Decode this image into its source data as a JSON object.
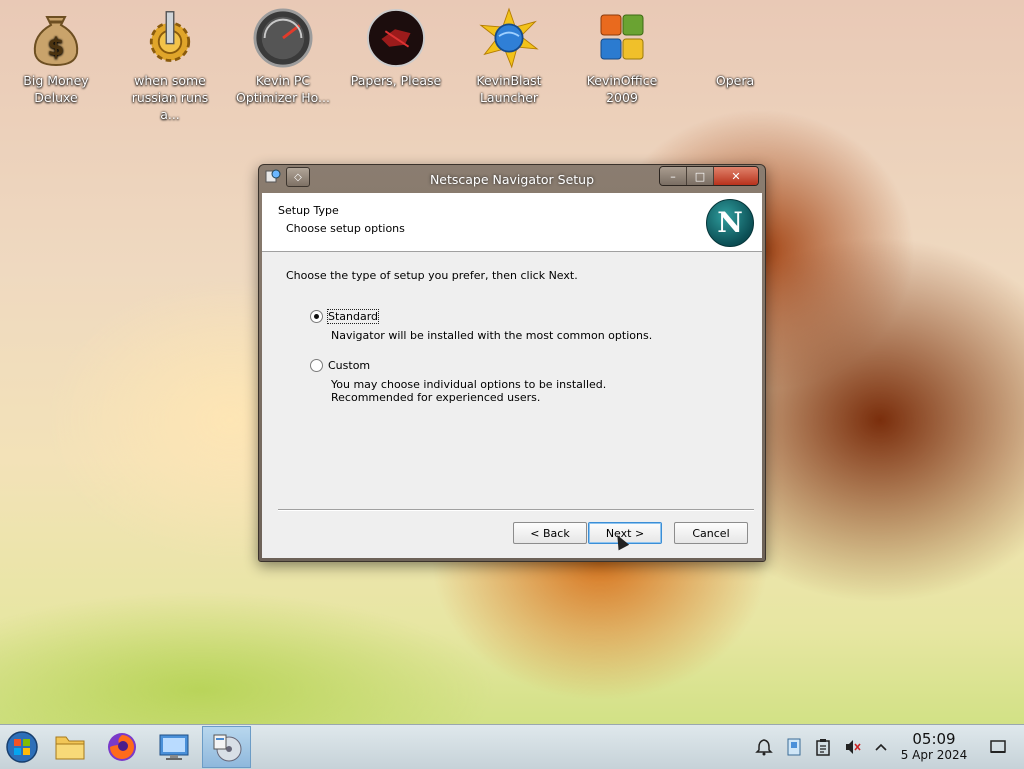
{
  "desktop": {
    "icons": [
      {
        "label": "Big Money Deluxe",
        "icon": "money-bag-icon"
      },
      {
        "label": "when some russian runs a...",
        "icon": "gear-icon"
      },
      {
        "label": "Kevin PC Optimizer Ho...",
        "icon": "gauge-icon"
      },
      {
        "label": "Papers, Please",
        "icon": "papers-please-icon"
      },
      {
        "label": "KevinBlast Launcher",
        "icon": "blast-globe-icon"
      },
      {
        "label": "KevinOffice 2009",
        "icon": "office-logo-icon"
      },
      {
        "label": "Opera",
        "icon": "opera-icon"
      }
    ]
  },
  "window": {
    "title": "Netscape Navigator Setup",
    "header_title": "Setup Type",
    "header_subtitle": "Choose setup options",
    "logo_letter": "N",
    "prompt": "Choose the type of setup you prefer, then click Next.",
    "options": [
      {
        "label": "Standard",
        "description": "Navigator will be installed with the most common options.",
        "selected": true
      },
      {
        "label": "Custom",
        "description": "You may choose individual options to be installed. Recommended for experienced users.",
        "selected": false
      }
    ],
    "buttons": {
      "back": "< Back",
      "next": "Next >",
      "cancel": "Cancel"
    },
    "controls": {
      "minimize": "–",
      "maximize": "□",
      "close": "✕"
    }
  },
  "taskbar": {
    "items": [
      "start-orb",
      "file-manager",
      "firefox",
      "control-panel",
      "installer"
    ],
    "clock": {
      "time": "05:09",
      "date": "5 Apr 2024"
    }
  }
}
